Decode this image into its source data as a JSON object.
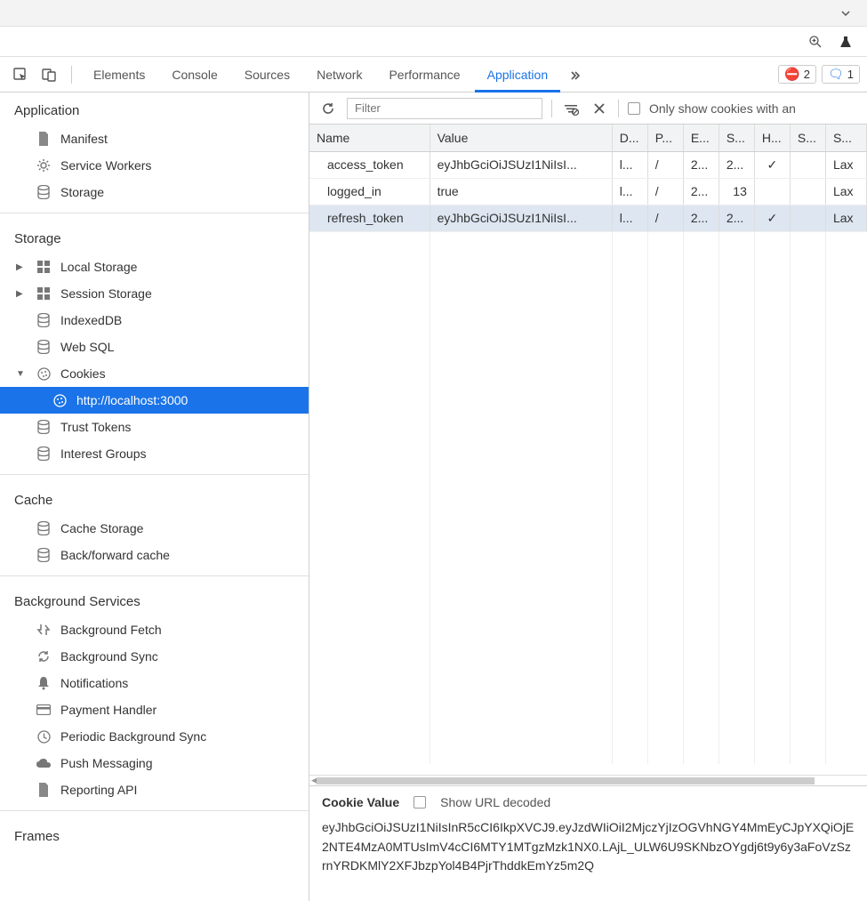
{
  "tabs": {
    "elements": "Elements",
    "console": "Console",
    "sources": "Sources",
    "network": "Network",
    "performance": "Performance",
    "application": "Application"
  },
  "badges": {
    "errors": "2",
    "messages": "1"
  },
  "toolbar": {
    "filter_placeholder": "Filter",
    "only_cookies": "Only show cookies with an"
  },
  "sidebar": {
    "application": {
      "title": "Application",
      "manifest": "Manifest",
      "service_workers": "Service Workers",
      "storage": "Storage"
    },
    "storage": {
      "title": "Storage",
      "local": "Local Storage",
      "session": "Session Storage",
      "indexeddb": "IndexedDB",
      "websql": "Web SQL",
      "cookies": "Cookies",
      "cookie_host": "http://localhost:3000",
      "trust_tokens": "Trust Tokens",
      "interest_groups": "Interest Groups"
    },
    "cache": {
      "title": "Cache",
      "cache_storage": "Cache Storage",
      "bf_cache": "Back/forward cache"
    },
    "bg": {
      "title": "Background Services",
      "fetch": "Background Fetch",
      "sync": "Background Sync",
      "notifications": "Notifications",
      "payment": "Payment Handler",
      "periodic": "Periodic Background Sync",
      "push": "Push Messaging",
      "reporting": "Reporting API"
    },
    "frames": {
      "title": "Frames"
    }
  },
  "table": {
    "headers": {
      "name": "Name",
      "value": "Value",
      "d": "D...",
      "p": "P...",
      "e": "E...",
      "s1": "S...",
      "h": "H...",
      "s2": "S...",
      "s3": "S..."
    },
    "rows": [
      {
        "name": "access_token",
        "value": "eyJhbGciOiJSUzI1NiIsI...",
        "d": "l...",
        "p": "/",
        "e": "2...",
        "s1": "2...",
        "h": "✓",
        "s2": "",
        "s3": "Lax"
      },
      {
        "name": "logged_in",
        "value": "true",
        "d": "l...",
        "p": "/",
        "e": "2...",
        "s1": "13",
        "h": "",
        "s2": "",
        "s3": "Lax"
      },
      {
        "name": "refresh_token",
        "value": "eyJhbGciOiJSUzI1NiIsI...",
        "d": "l...",
        "p": "/",
        "e": "2...",
        "s1": "2...",
        "h": "✓",
        "s2": "",
        "s3": "Lax"
      }
    ]
  },
  "detail": {
    "label": "Cookie Value",
    "show_decoded": "Show URL decoded",
    "value": "eyJhbGciOiJSUzI1NiIsInR5cCI6IkpXVCJ9.eyJzdWIiOiI2MjczYjIzOGVhNGY4MmEyCJpYXQiOjE2NTE4MzA0MTUsImV4cCI6MTY1MTgzMzk1NX0.LAjL_ULW6U9SKNbzOYgdj6t9y6y3aFoVzSzrnYRDKMlY2XFJbzpYol4B4PjrThddkEmYz5m2Q"
  }
}
